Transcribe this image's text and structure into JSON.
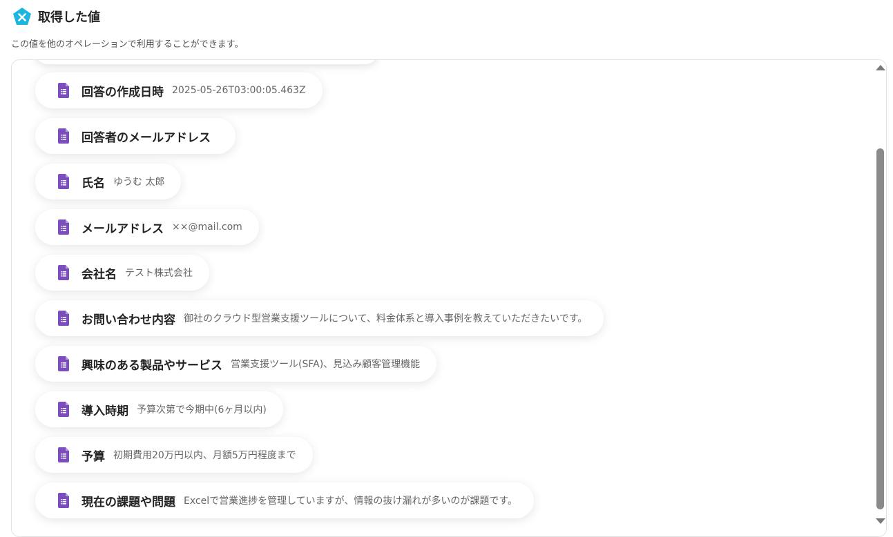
{
  "header": {
    "title": "取得した値",
    "logo_icon": "yoom-logo-icon",
    "logo_color": "#1ab6e0"
  },
  "description": "この値を他のオペレーションで利用することができます。",
  "item_icon": "google-forms-document-icon",
  "item_icon_color": "#7c4dbd",
  "items": [
    {
      "label": "回答の作成日時",
      "value": "2025-05-26T03:00:05.463Z"
    },
    {
      "label": "回答者のメールアドレス",
      "value": ""
    },
    {
      "label": "氏名",
      "value": "ゆうむ 太郎"
    },
    {
      "label": "メールアドレス",
      "value": "××@mail.com"
    },
    {
      "label": "会社名",
      "value": "テスト株式会社"
    },
    {
      "label": "お問い合わせ内容",
      "value": "御社のクラウド型営業支援ツールについて、料金体系と導入事例を教えていただきたいです。"
    },
    {
      "label": "興味のある製品やサービス",
      "value": "営業支援ツール(SFA)、見込み顧客管理機能"
    },
    {
      "label": "導入時期",
      "value": "予算次第で今期中(6ヶ月以内)"
    },
    {
      "label": "予算",
      "value": "初期費用20万円以内、月額5万円程度まで"
    },
    {
      "label": "現在の課題や問題",
      "value": "Excelで営業進捗を管理していますが、情報の抜け漏れが多いのが課題です。"
    }
  ]
}
